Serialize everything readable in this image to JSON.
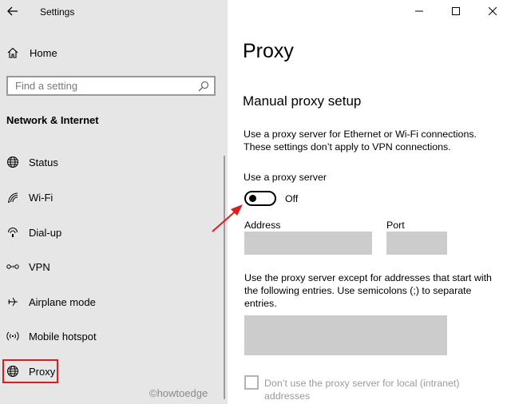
{
  "app": {
    "title": "Settings"
  },
  "sidebar": {
    "home_label": "Home",
    "search_placeholder": "Find a setting",
    "section_title": "Network & Internet",
    "items": [
      {
        "label": "Status",
        "icon": "globe-status-icon"
      },
      {
        "label": "Wi-Fi",
        "icon": "wifi-icon"
      },
      {
        "label": "Dial-up",
        "icon": "dialup-icon"
      },
      {
        "label": "VPN",
        "icon": "vpn-icon"
      },
      {
        "label": "Airplane mode",
        "icon": "airplane-icon"
      },
      {
        "label": "Mobile hotspot",
        "icon": "hotspot-icon"
      },
      {
        "label": "Proxy",
        "icon": "globe-icon",
        "selected": true
      }
    ],
    "watermark": "©howtoedge"
  },
  "main": {
    "page_title": "Proxy",
    "section_title": "Manual proxy setup",
    "description": "Use a proxy server for Ethernet or Wi-Fi connections. These settings don’t apply to VPN connections.",
    "use_proxy_label": "Use a proxy server",
    "use_proxy_state": "Off",
    "address_label": "Address",
    "address_value": "",
    "port_label": "Port",
    "port_value": "",
    "exceptions_label": "Use the proxy server except for addresses that start with the following entries. Use semicolons (;) to separate entries.",
    "exceptions_value": "",
    "local_checkbox_label": "Don’t use the proxy server for local (intranet) addresses",
    "local_checkbox_checked": false
  },
  "colors": {
    "sidebar_bg": "#e6e6e6",
    "highlight_red": "#e01b1b",
    "input_disabled": "#cccccc"
  }
}
